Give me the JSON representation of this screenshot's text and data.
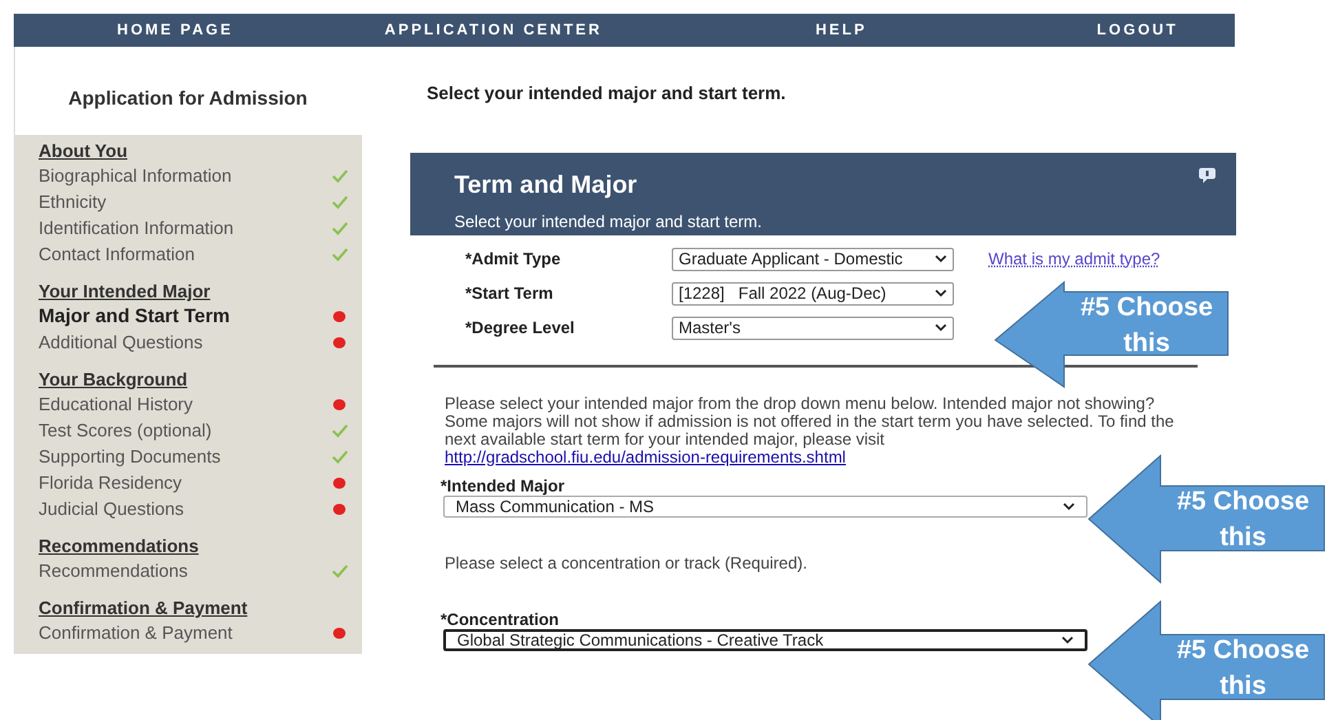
{
  "top_nav": [
    {
      "label": "HOME PAGE"
    },
    {
      "label": "APPLICATION CENTER"
    },
    {
      "label": "HELP"
    },
    {
      "label": "LOGOUT"
    }
  ],
  "sidebar": {
    "title": "Application for Admission",
    "sections": [
      {
        "heading": "About You",
        "items": [
          {
            "label": "Biographical Information",
            "complete": true,
            "selected": false
          },
          {
            "label": "Ethnicity",
            "complete": true,
            "selected": false
          },
          {
            "label": "Identification Information",
            "complete": true,
            "selected": false
          },
          {
            "label": "Contact Information",
            "complete": true,
            "selected": false
          }
        ]
      },
      {
        "heading": "Your Intended Major",
        "items": [
          {
            "label": "Major and Start Term",
            "complete": false,
            "selected": true
          },
          {
            "label": "Additional Questions",
            "complete": false,
            "selected": false
          }
        ]
      },
      {
        "heading": "Your Background",
        "items": [
          {
            "label": "Educational History",
            "complete": false,
            "selected": false
          },
          {
            "label": "Test Scores (optional)",
            "complete": true,
            "selected": false
          },
          {
            "label": "Supporting Documents",
            "complete": true,
            "selected": false
          },
          {
            "label": "Florida Residency",
            "complete": false,
            "selected": false
          },
          {
            "label": "Judicial Questions",
            "complete": false,
            "selected": false
          }
        ]
      },
      {
        "heading": "Recommendations",
        "items": [
          {
            "label": "Recommendations",
            "complete": true,
            "selected": false
          }
        ]
      },
      {
        "heading": "Confirmation & Payment",
        "items": [
          {
            "label": "Confirmation & Payment",
            "complete": false,
            "selected": false
          }
        ]
      }
    ]
  },
  "page_heading": "Select your intended major and start term.",
  "panel": {
    "title": "Term and Major",
    "subtitle": "Select your intended major and start term."
  },
  "term_fields": [
    {
      "label": "*Admit Type",
      "value": "Graduate Applicant - Domestic",
      "link": "What is my admit type?"
    },
    {
      "label": "*Start Term",
      "value": "[1228]   Fall 2022 (Aug-Dec)"
    },
    {
      "label": "*Degree Level",
      "value": "Master's"
    }
  ],
  "major_note": {
    "text": "Please select your intended major from the drop down menu below. Intended major not showing? Some majors will not show if admission is not offered in the start term you have selected. To find the next available start term for your intended major, please visit ",
    "link": "http://gradschool.fiu.edu/admission-requirements.shtml"
  },
  "intended_major": {
    "label": "*Intended Major",
    "value": "Mass Communication - MS",
    "focused": false
  },
  "concentration_note": "Please select a concentration or track (Required).",
  "concentration": {
    "label": "*Concentration",
    "value": "Global Strategic Communications - Creative Track",
    "focused": true
  },
  "callouts": [
    {
      "text": "#5 Choose this"
    },
    {
      "text": "#5 Choose this"
    },
    {
      "text": "#5 Choose this"
    }
  ]
}
